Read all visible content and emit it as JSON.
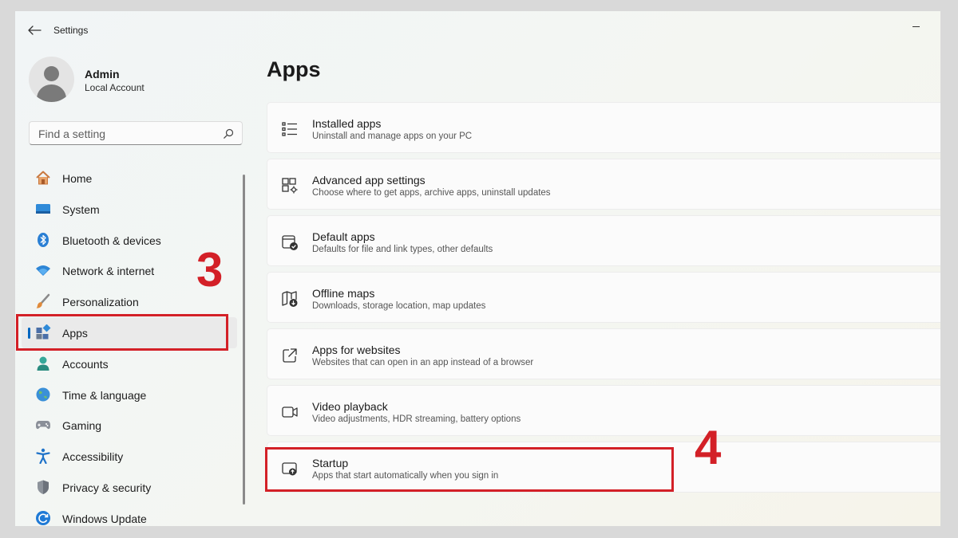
{
  "window": {
    "title": "Settings"
  },
  "user": {
    "name": "Admin",
    "account_type": "Local Account"
  },
  "search": {
    "placeholder": "Find a setting"
  },
  "sidebar": {
    "items": [
      {
        "label": "Home",
        "icon": "home-icon"
      },
      {
        "label": "System",
        "icon": "system-icon"
      },
      {
        "label": "Bluetooth & devices",
        "icon": "bluetooth-icon"
      },
      {
        "label": "Network & internet",
        "icon": "wifi-icon"
      },
      {
        "label": "Personalization",
        "icon": "brush-icon"
      },
      {
        "label": "Apps",
        "icon": "apps-icon",
        "selected": true
      },
      {
        "label": "Accounts",
        "icon": "accounts-icon"
      },
      {
        "label": "Time & language",
        "icon": "globe-icon"
      },
      {
        "label": "Gaming",
        "icon": "gamepad-icon"
      },
      {
        "label": "Accessibility",
        "icon": "accessibility-icon"
      },
      {
        "label": "Privacy & security",
        "icon": "shield-icon"
      },
      {
        "label": "Windows Update",
        "icon": "update-icon"
      }
    ]
  },
  "main": {
    "title": "Apps",
    "cards": [
      {
        "title": "Installed apps",
        "subtitle": "Uninstall and manage apps on your PC",
        "icon": "list-icon"
      },
      {
        "title": "Advanced app settings",
        "subtitle": "Choose where to get apps, archive apps, uninstall updates",
        "icon": "app-settings-icon"
      },
      {
        "title": "Default apps",
        "subtitle": "Defaults for file and link types, other defaults",
        "icon": "default-apps-icon"
      },
      {
        "title": "Offline maps",
        "subtitle": "Downloads, storage location, map updates",
        "icon": "map-icon"
      },
      {
        "title": "Apps for websites",
        "subtitle": "Websites that can open in an app instead of a browser",
        "icon": "open-external-icon"
      },
      {
        "title": "Video playback",
        "subtitle": "Video adjustments, HDR streaming, battery options",
        "icon": "video-icon"
      },
      {
        "title": "Startup",
        "subtitle": "Apps that start automatically when you sign in",
        "icon": "startup-icon"
      }
    ]
  },
  "annotations": {
    "step3": "3",
    "step4": "4",
    "color": "#d32027"
  },
  "colors": {
    "accent": "#0067c0"
  }
}
